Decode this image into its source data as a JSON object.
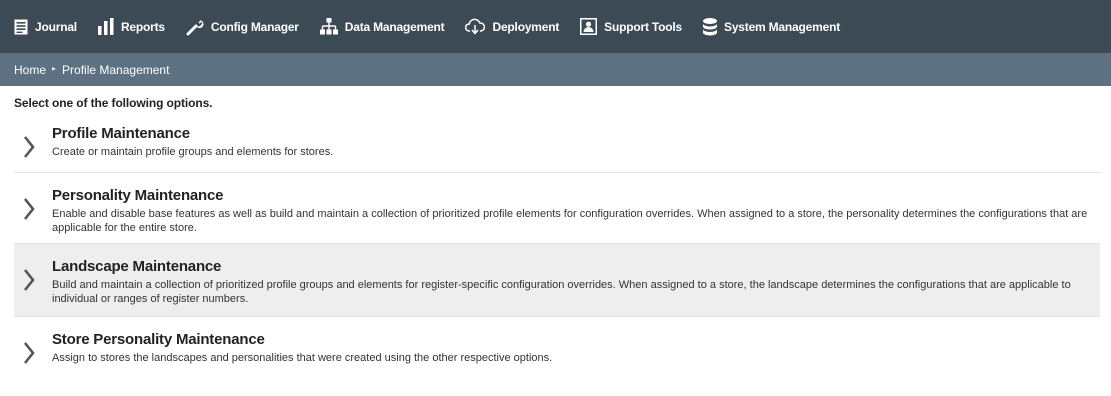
{
  "nav": {
    "items": [
      {
        "label": "Journal",
        "icon": "journal-icon"
      },
      {
        "label": "Reports",
        "icon": "bar-chart-icon"
      },
      {
        "label": "Config Manager",
        "icon": "wrench-icon"
      },
      {
        "label": "Data Management",
        "icon": "hierarchy-icon"
      },
      {
        "label": "Deployment",
        "icon": "cloud-download-icon"
      },
      {
        "label": "Support Tools",
        "icon": "support-user-icon"
      },
      {
        "label": "System Management",
        "icon": "database-icon"
      }
    ]
  },
  "breadcrumb": {
    "home": "Home",
    "separator": "▸",
    "current": "Profile Management"
  },
  "main": {
    "instruction": "Select one of the following options.",
    "options": [
      {
        "title": "Profile Maintenance",
        "description": "Create or maintain profile groups and elements for stores."
      },
      {
        "title": "Personality Maintenance",
        "description": "Enable and disable base features as well as build and maintain a collection of prioritized profile elements for configuration overrides. When assigned to a store, the personality determines the configurations that are applicable for the entire store."
      },
      {
        "title": "Landscape Maintenance",
        "description": "Build and maintain a collection of prioritized profile groups and elements for register-specific configuration overrides. When assigned to a store, the landscape determines the configurations that are applicable to individual or ranges of register numbers."
      },
      {
        "title": "Store Personality Maintenance",
        "description": "Assign to stores the landscapes and personalities that were created using the other respective options."
      }
    ]
  },
  "colors": {
    "topnav_bg": "#3c4a56",
    "breadcrumb_bg": "#5d7182",
    "highlight_bg": "#eeeeee"
  }
}
